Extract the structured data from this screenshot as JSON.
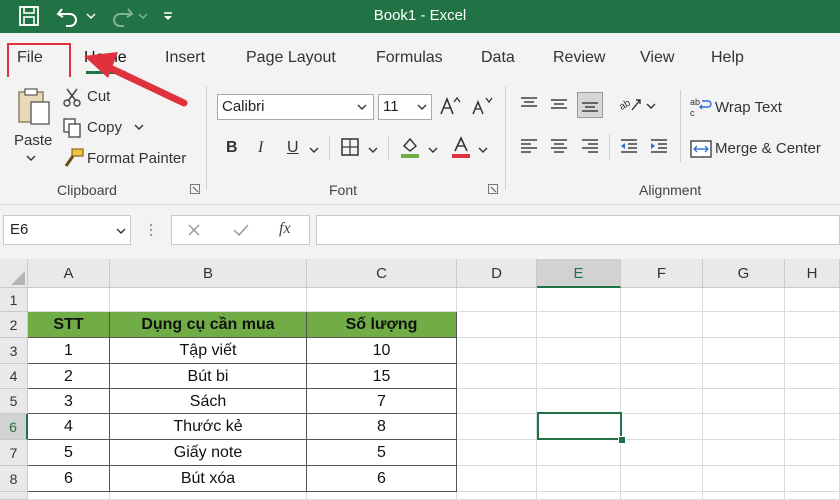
{
  "title_bar": {
    "title": "Book1  -  Excel"
  },
  "tabs": [
    "File",
    "Home",
    "Insert",
    "Page Layout",
    "Formulas",
    "Data",
    "Review",
    "View",
    "Help"
  ],
  "ribbon": {
    "clipboard": {
      "paste": "Paste",
      "cut": "Cut",
      "copy": "Copy",
      "format_painter": "Format Painter",
      "label": "Clipboard"
    },
    "font": {
      "font_name": "Calibri",
      "font_size": "11",
      "label": "Font",
      "bold": "B",
      "italic": "I",
      "underline": "U"
    },
    "alignment": {
      "wrap_text": "Wrap Text",
      "merge_center": "Merge & Center",
      "label": "Alignment"
    }
  },
  "formula_bar": {
    "name_box": "E6",
    "fx": "fx",
    "formula": ""
  },
  "columns": [
    "A",
    "B",
    "C",
    "D",
    "E",
    "F",
    "G",
    "H"
  ],
  "selected_column": "E",
  "rows": [
    "1",
    "2",
    "3",
    "4",
    "5",
    "6",
    "7",
    "8"
  ],
  "selected_row": "6",
  "table": {
    "headers": [
      "STT",
      "Dụng cụ cần mua",
      "Số lượng"
    ],
    "rows": [
      [
        "1",
        "Tập viết",
        "10"
      ],
      [
        "2",
        "Bút bi",
        "15"
      ],
      [
        "3",
        "Sách",
        "7"
      ],
      [
        "4",
        "Thước kẻ",
        "8"
      ],
      [
        "5",
        "Giấy note",
        "5"
      ],
      [
        "6",
        "Bút xóa",
        "6"
      ]
    ]
  },
  "colors": {
    "excel_green": "#217346",
    "header_fill": "#70ad47",
    "annotation": "#e0323c"
  }
}
